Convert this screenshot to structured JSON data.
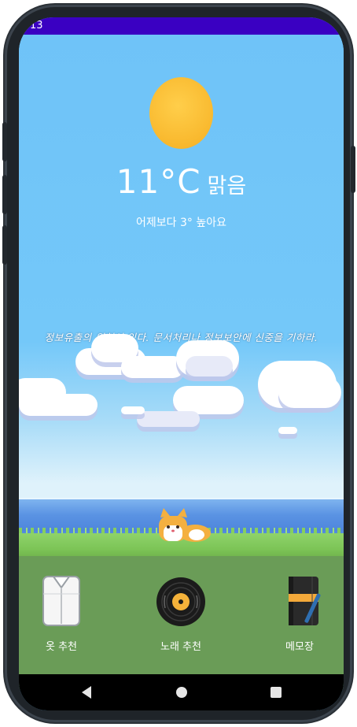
{
  "status_bar": {
    "time": "13"
  },
  "weather": {
    "temperature": "11°C",
    "condition": "맑음",
    "comparison": "어제보다 3° 높아요"
  },
  "banner": {
    "message": "정보유출의 위험이 있다. 문서처리나 정보보안에 신중을 기하라."
  },
  "menu": [
    {
      "label": "옷 추천",
      "icon": "shirt-icon"
    },
    {
      "label": "노래 추천",
      "icon": "vinyl-record-icon"
    },
    {
      "label": "메모장",
      "icon": "notebook-pen-icon"
    }
  ],
  "navigation": {
    "back": "back-icon",
    "home": "home-icon",
    "recent": "recent-apps-icon"
  },
  "colors": {
    "status_bar": "#3a00c2",
    "sky": "#6ec4f8",
    "sun": "#f8b72c",
    "grass": "#6a9c57",
    "nav_bar": "#000000"
  }
}
